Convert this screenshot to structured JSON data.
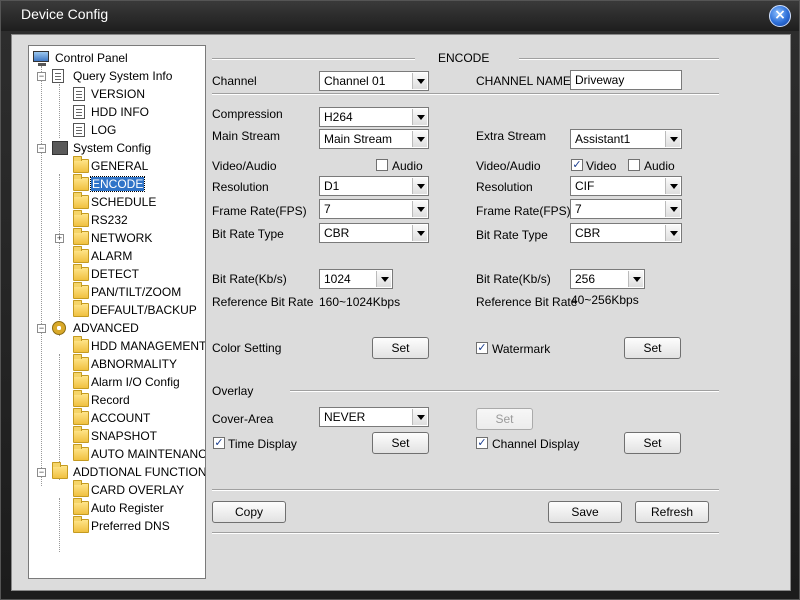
{
  "window": {
    "title": "Device Config"
  },
  "tree": {
    "root": "Control Panel",
    "query": "Query System Info",
    "version": "VERSION",
    "hdd_info": "HDD INFO",
    "log": "LOG",
    "system": "System Config",
    "general": "GENERAL",
    "encode": "ENCODE",
    "schedule": "SCHEDULE",
    "rs232": "RS232",
    "network": "NETWORK",
    "alarm": "ALARM",
    "detect": "DETECT",
    "ptz": "PAN/TILT/ZOOM",
    "default_backup": "DEFAULT/BACKUP",
    "advanced": "ADVANCED",
    "hdd_mgmt": "HDD MANAGEMENT",
    "abnormality": "ABNORMALITY",
    "alarm_io": "Alarm I/O Config",
    "record": "Record",
    "account": "ACCOUNT",
    "snapshot": "SNAPSHOT",
    "auto_maint": "AUTO MAINTENANC",
    "addtional": "ADDTIONAL FUNCTION",
    "card_overlay": "CARD OVERLAY",
    "auto_register": "Auto Register",
    "preferred_dns": "Preferred DNS"
  },
  "encode": {
    "section_title": "ENCODE",
    "channel_label": "Channel",
    "channel_value": "Channel 01",
    "channel_name_label": "CHANNEL NAME",
    "channel_name_value": "Driveway",
    "compression_label": "Compression",
    "compression_value": "H264",
    "main_stream_label": "Main Stream",
    "main_stream_value": "Main Stream",
    "extra_stream_label": "Extra Stream",
    "extra_stream_value": "Assistant1",
    "video_audio_label": "Video/Audio",
    "audio_label": "Audio",
    "video_label": "Video",
    "resolution_label": "Resolution",
    "main_resolution": "D1",
    "extra_resolution": "CIF",
    "frame_rate_label": "Frame Rate(FPS)",
    "main_frame_rate": "7",
    "extra_frame_rate": "7",
    "bit_rate_type_label": "Bit Rate Type",
    "main_bit_rate_type": "CBR",
    "extra_bit_rate_type": "CBR",
    "bit_rate_label": "Bit Rate(Kb/s)",
    "main_bit_rate": "1024",
    "extra_bit_rate": "256",
    "ref_bit_rate_label": "Reference Bit Rate",
    "main_ref_bit_rate": "160~1024Kbps",
    "extra_ref_bit_rate": "40~256Kbps",
    "color_setting_label": "Color Setting",
    "watermark_label": "Watermark",
    "set_label": "Set",
    "overlay_label": "Overlay",
    "cover_area_label": "Cover-Area",
    "cover_area_value": "NEVER",
    "time_display_label": "Time Display",
    "channel_display_label": "Channel Display",
    "copy_label": "Copy",
    "save_label": "Save",
    "refresh_label": "Refresh",
    "check_mark": "✓",
    "main_audio_checked": false,
    "extra_video_checked": true,
    "extra_audio_checked": false,
    "watermark_checked": true,
    "time_display_checked": true,
    "channel_display_checked": true
  },
  "icons": {
    "close": "close-icon",
    "folder": "folder-icon",
    "document": "document-icon"
  },
  "colors": {
    "selection": "#3074c8",
    "title_bar": "#2e2e2e",
    "close_button": "#2d6fd8"
  }
}
